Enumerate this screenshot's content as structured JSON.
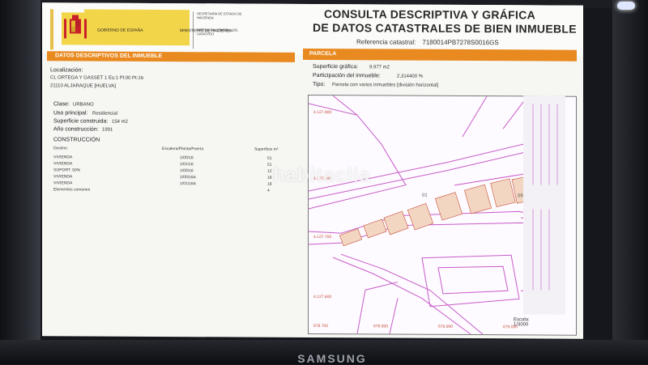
{
  "header": {
    "gov_line1": "GOBIERNO DE ESPAÑA",
    "gov_line2": "MINISTERIO DE HACIENDA",
    "sec_line1": "SECRETARÍA DE ESTADO DE HACIENDA",
    "sec_line2": "DIRECCIÓN GENERAL DEL CATASTRO",
    "title_line1": "CONSULTA DESCRIPTIVA Y GRÁFICA",
    "title_line2": "DE DATOS CATASTRALES DE BIEN INMUEBLE",
    "ref_label": "Referencia catastral:",
    "ref_value": "7180014PB7278S0016GS"
  },
  "left": {
    "section_title": "DATOS DESCRIPTIVOS DEL INMUEBLE",
    "localizacion_label": "Localización:",
    "address_line1": "CL ORTEGA Y GASSET 1 Es:1 Pl:00 Pt:16",
    "address_line2": "21110 ALJARAQUE [HUELVA]",
    "clase_label": "Clase:",
    "clase_value": "URBANO",
    "uso_label": "Uso principal:",
    "uso_value": "Residencial",
    "superficie_label": "Superficie construida:",
    "superficie_value": "154 m2",
    "anio_label": "Año construcción:",
    "anio_value": "1991",
    "construccion_title": "CONSTRUCCIÓN",
    "table_headers": [
      "Destino",
      "Escalera/Planta/Puerta",
      "Superficie m²"
    ],
    "rows": [
      [
        "VIVIENDA",
        "1/00/16",
        "51"
      ],
      [
        "VIVIENDA",
        "1/01/16",
        "51"
      ],
      [
        "SOPORT. 50%",
        "1/00/16",
        "12"
      ],
      [
        "VIVIENDA",
        "1/00/16A",
        "18"
      ],
      [
        "VIVIENDA",
        "1/01/16A",
        "18"
      ],
      [
        "Elementos comunes",
        "",
        "4"
      ]
    ]
  },
  "right": {
    "section_title": "PARCELA",
    "superficie_grafica_label": "Superficie gráfica:",
    "superficie_grafica_value": "9.977 m2",
    "participacion_label": "Participación del inmueble:",
    "participacion_value": "2,314400 %",
    "tipo_label": "Tipo:",
    "tipo_value": "Parcela con varios inmuebles [división horizontal]",
    "map_labels": [
      "4.127.900",
      "4.127.800",
      "4.127.700",
      "4.127.600",
      "678.700",
      "678.800",
      "678.900",
      "679.000",
      "01",
      "09"
    ],
    "scale_label": "Escala:",
    "scale_value": "1/3000"
  },
  "watermark": "habitaclia",
  "monitor_brand": "SAMSUNG",
  "colors": {
    "accent": "#e98a20",
    "map_lines": "#c85ac8",
    "buildings": "#d9806a"
  }
}
